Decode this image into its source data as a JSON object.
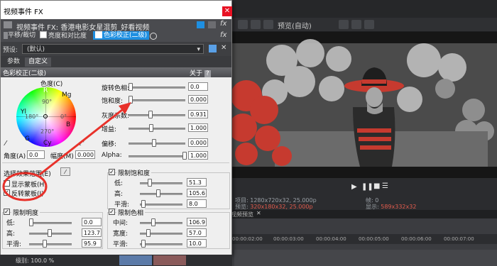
{
  "colors": {
    "accent": "#1e8fe1",
    "annotation": "#e8312a",
    "dialog_bg": "#f0f0f0",
    "video_red": "#c63a2f"
  },
  "dialog": {
    "title": "视频事件 FX",
    "chain_title": "视频事件 FX:",
    "chain_name": "香港电影女星混剪_好看视频",
    "crumbs": [
      {
        "label": "平移/裁切"
      },
      {
        "label": "亮度和对比度"
      },
      {
        "label": "色彩校正(二级)"
      }
    ],
    "preset_label": "预设:",
    "preset_value": "(默认)",
    "tabs": [
      "参数",
      "自定义"
    ],
    "panel_title": "色彩校正(二级)",
    "about": "关于",
    "help": "?"
  },
  "wheel": {
    "title": "色度(C)",
    "labels": {
      "r": "R",
      "mg": "Mg",
      "yl": "Yl",
      "b": "B",
      "g": "G",
      "cy": "Cy"
    },
    "deg90": "90°",
    "deg180": "180°",
    "deg0": "0°",
    "deg270": "270°",
    "angle_label": "角度(A)",
    "angle_value": "0.0",
    "magnitude_label": "幅度(M)",
    "magnitude_value": "0.000"
  },
  "sliders": [
    {
      "label": "旋转色相:",
      "value": "0.0",
      "level": 0.0
    },
    {
      "label": "饱和度:",
      "value": "0.000",
      "level": 0.0
    },
    {
      "label": "灰度系数:",
      "value": "0.931",
      "level": 0.37
    },
    {
      "label": "增益:",
      "value": "1.000",
      "level": 0.38
    },
    {
      "label": "偏移:",
      "value": "0.000",
      "level": 0.43
    },
    {
      "label": "Alpha:",
      "value": "1.000",
      "level": 1.0
    }
  ],
  "select_range": {
    "label": "选择效果范围(E)"
  },
  "mask": {
    "show_label": "显示蒙板(H)",
    "show_checked": false,
    "invert_label": "反转蒙板(I)",
    "invert_checked": true
  },
  "limit_lum": {
    "title": "限制明度",
    "checked": true,
    "rows": [
      {
        "label": "低:",
        "value": "0.0",
        "level": 0.0
      },
      {
        "label": "高:",
        "value": "123.7",
        "level": 0.48
      },
      {
        "label": "平滑:",
        "value": "95.9",
        "level": 0.35
      }
    ]
  },
  "limit_sat": {
    "title": "限制饱和度",
    "checked": true,
    "rows": [
      {
        "label": "低:",
        "value": "51.3",
        "level": 0.2
      },
      {
        "label": "高:",
        "value": "105.6",
        "level": 0.42
      },
      {
        "label": "平滑:",
        "value": "8.0",
        "level": 0.03
      }
    ]
  },
  "limit_hue": {
    "title": "限制色相",
    "checked": true,
    "rows": [
      {
        "label": "中间:",
        "value": "106.9",
        "level": 0.3
      },
      {
        "label": "宽度:",
        "value": "57.0",
        "level": 0.16
      },
      {
        "label": "平滑:",
        "value": "10.0",
        "level": 0.03
      }
    ]
  },
  "preview": {
    "mode": "预览(自动)"
  },
  "info": {
    "project_label": "项目:",
    "project_value": "1280x720x32, 25.000p",
    "preview_label": "预览:",
    "preview_value": "320x180x32, 25.000p",
    "frame_label": "帧:",
    "frame_value": "0",
    "display_label": "显示:",
    "display_value": "589x332x32"
  },
  "timeline": {
    "tab": "视频预览",
    "ticks": [
      "00:00:02:00",
      "00:00:03:00",
      "00:00:04:00",
      "00:00:05:00",
      "00:00:06:00",
      "00:00:07:00"
    ],
    "zoom": "级别: 100.0 %"
  }
}
